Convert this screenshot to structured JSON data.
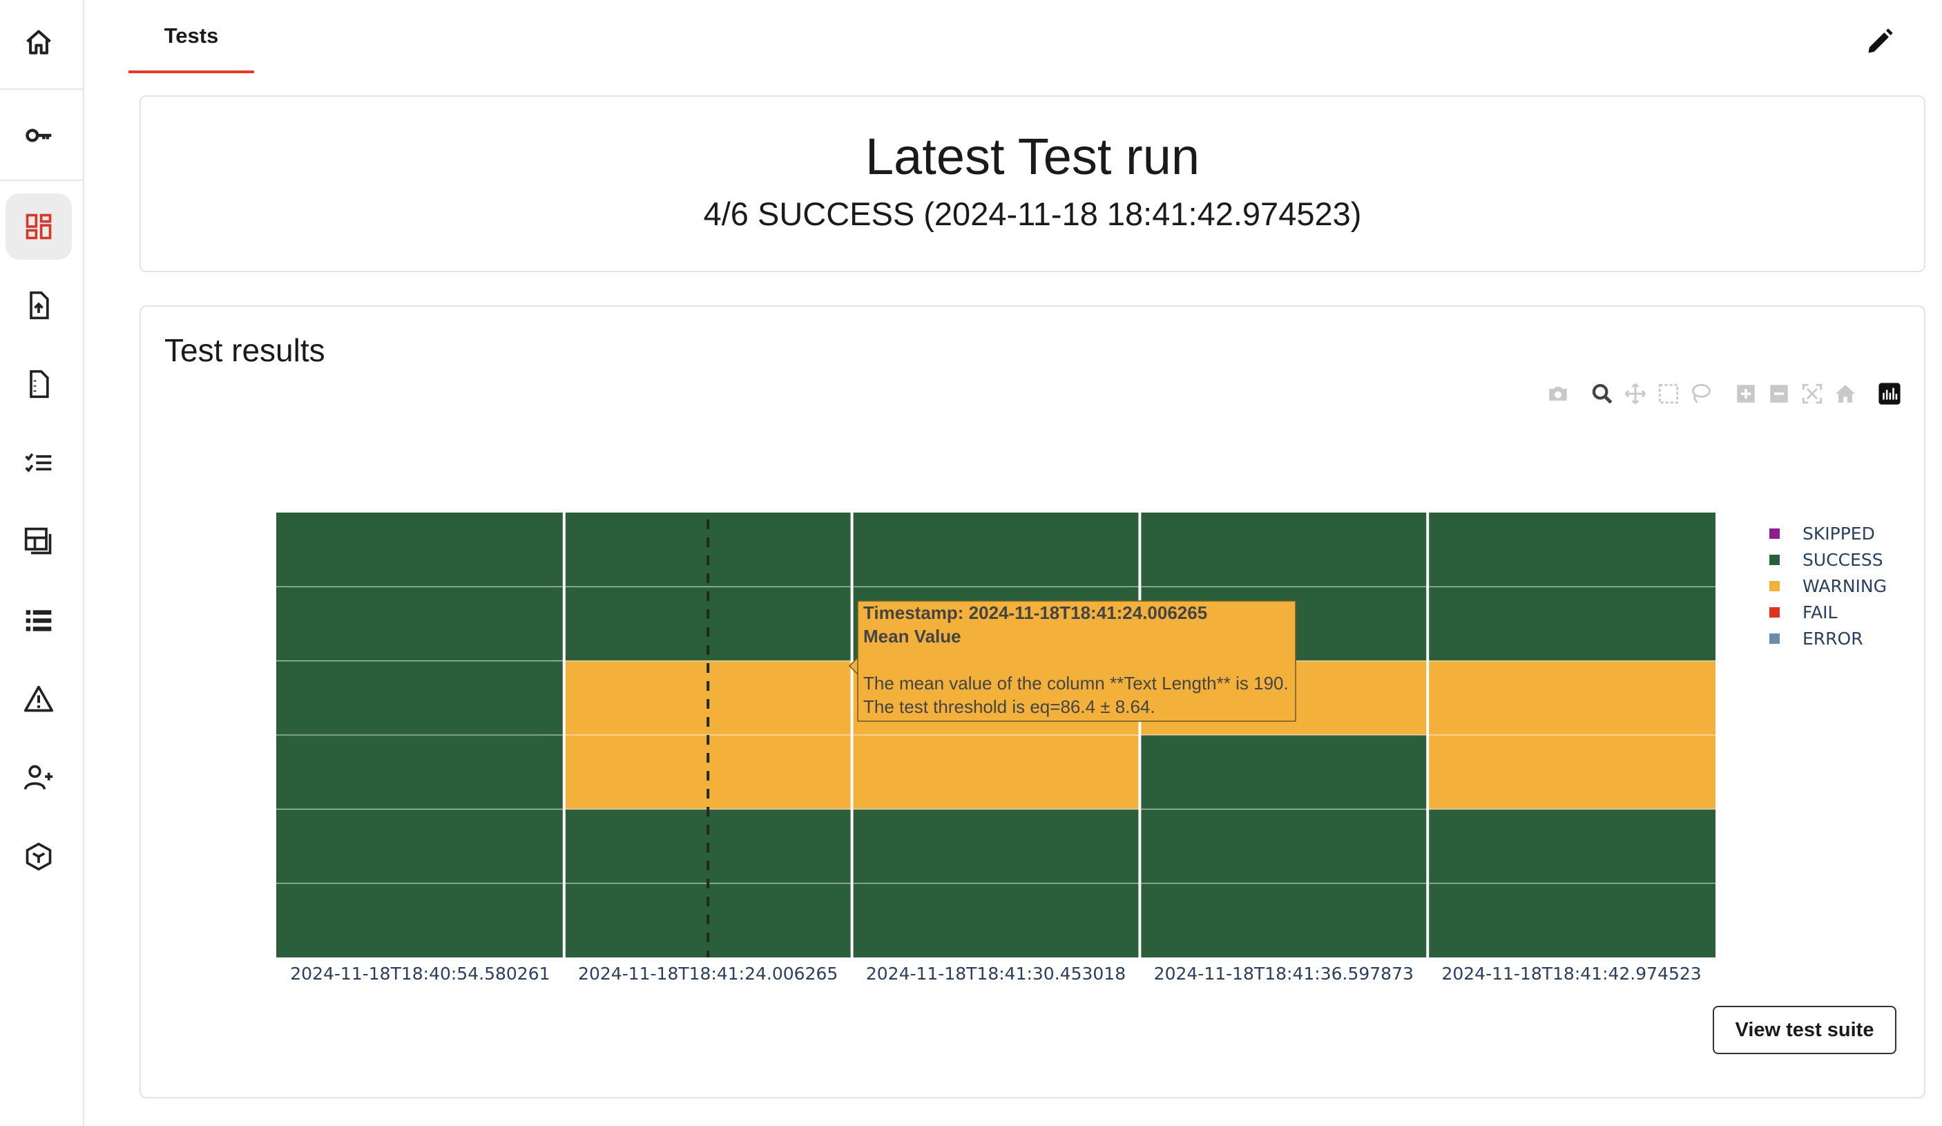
{
  "tabs": [
    {
      "label": "Tests",
      "active": true
    }
  ],
  "sidebar": {
    "items": [
      {
        "icon": "home-icon"
      },
      {
        "icon": "key-icon"
      },
      {
        "icon": "dashboard-icon",
        "active": true
      },
      {
        "icon": "file-upload-icon"
      },
      {
        "icon": "document-icon"
      },
      {
        "icon": "checklist-icon"
      },
      {
        "icon": "layers-icon"
      },
      {
        "icon": "list-icon"
      },
      {
        "icon": "warning-icon"
      },
      {
        "icon": "add-user-icon"
      },
      {
        "icon": "box-icon"
      }
    ]
  },
  "latest_run": {
    "title": "Latest Test run",
    "summary": "4/6 SUCCESS (2024-11-18 18:41:42.974523)"
  },
  "results": {
    "title": "Test results",
    "modebar": [
      "camera-icon",
      "zoom-icon",
      "pan-icon",
      "box-select-icon",
      "lasso-icon",
      "zoom-in-icon",
      "zoom-out-icon",
      "autoscale-icon",
      "reset-axes-icon",
      "plotly-logo-icon"
    ],
    "view_button": "View test suite"
  },
  "colors": {
    "SKIPPED": "#8e1d8e",
    "SUCCESS": "#2b5e3b",
    "WARNING": "#f3b13c",
    "FAIL": "#e0321f",
    "ERROR": "#6e8ca8",
    "accent": "#e8382a"
  },
  "chart_data": {
    "type": "heatmap",
    "x": [
      "2024-11-18T18:40:54.580261",
      "2024-11-18T18:41:24.006265",
      "2024-11-18T18:41:30.453018",
      "2024-11-18T18:41:36.597873",
      "2024-11-18T18:41:42.974523"
    ],
    "rows": 6,
    "status_grid": [
      [
        "SUCCESS",
        "SUCCESS",
        "SUCCESS",
        "SUCCESS",
        "SUCCESS"
      ],
      [
        "SUCCESS",
        "SUCCESS",
        "SUCCESS",
        "SUCCESS",
        "SUCCESS"
      ],
      [
        "SUCCESS",
        "WARNING",
        "WARNING",
        "WARNING",
        "WARNING"
      ],
      [
        "SUCCESS",
        "WARNING",
        "WARNING",
        "SUCCESS",
        "WARNING"
      ],
      [
        "SUCCESS",
        "SUCCESS",
        "SUCCESS",
        "SUCCESS",
        "SUCCESS"
      ],
      [
        "SUCCESS",
        "SUCCESS",
        "SUCCESS",
        "SUCCESS",
        "SUCCESS"
      ]
    ],
    "legend": [
      "SKIPPED",
      "SUCCESS",
      "WARNING",
      "FAIL",
      "ERROR"
    ],
    "legend_position": "right",
    "hover_column": "2024-11-18T18:41:24.006265",
    "tooltip": {
      "lines_bold": [
        "Timestamp: 2024-11-18T18:41:24.006265",
        "Mean Value"
      ],
      "lines": [
        "The mean value of the column **Text Length** is 190.",
        "The test threshold is eq=86.4 ± 8.64."
      ]
    }
  }
}
